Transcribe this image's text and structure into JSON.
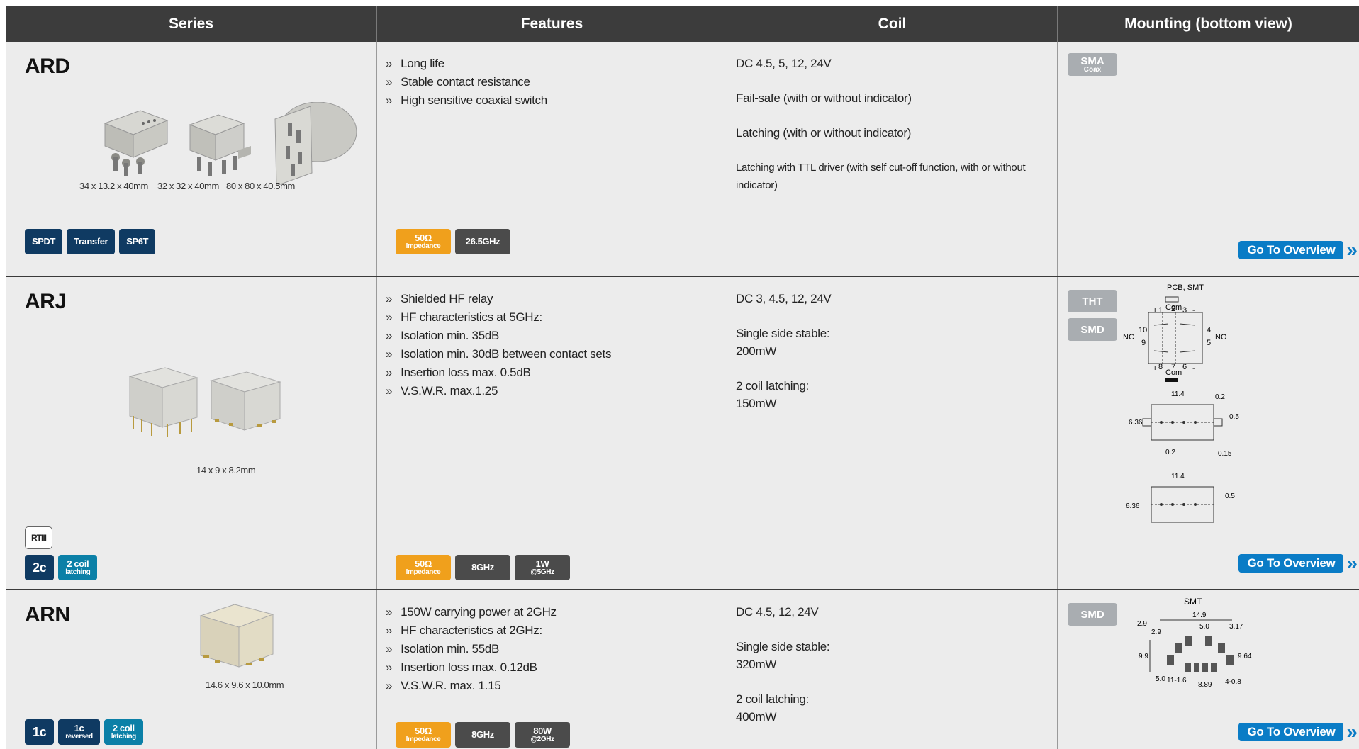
{
  "header": {
    "series": "Series",
    "features": "Features",
    "coil": "Coil",
    "mounting": "Mounting (bottom view)"
  },
  "overview_label": "Go To Overview",
  "rows": [
    {
      "name": "ARD",
      "dims": [
        "34 x 13.2 x 40mm",
        "32 x 32 x 40mm",
        "80 x 80 x 40.5mm"
      ],
      "badges": [
        "SPDT",
        "Transfer",
        "SP6T"
      ],
      "features": [
        "Long life",
        "Stable contact resistance",
        "High sensitive coaxial switch"
      ],
      "feature_badges": [
        {
          "main": "50Ω",
          "sub": "Impedance"
        },
        {
          "main": "26.5GHz"
        }
      ],
      "coil": [
        "DC 4.5, 5, 12, 24V",
        "Fail-safe (with or without indicator)",
        "Latching (with or without indicator)",
        "Latching with TTL driver (with self cut-off function, with or without indicator)"
      ],
      "mounting": [
        {
          "main": "SMA",
          "sub": "Coax"
        }
      ]
    },
    {
      "name": "ARJ",
      "dims": [
        "14 x 9 x 8.2mm"
      ],
      "rt": "RTIII",
      "badges": [
        {
          "main": "2c"
        },
        {
          "main": "2 coil",
          "sub": "latching"
        }
      ],
      "features": [
        "Shielded HF relay",
        "HF characteristics at 5GHz:",
        "Isolation min. 35dB",
        "Isolation min. 30dB between contact sets",
        "Insertion loss max. 0.5dB",
        "V.S.W.R. max.1.25"
      ],
      "feature_badges": [
        {
          "main": "50Ω",
          "sub": "Impedance"
        },
        {
          "main": "8GHz"
        },
        {
          "main": "1W",
          "sub": "@5GHz"
        }
      ],
      "coil": [
        "DC 3, 4.5, 12, 24V",
        "Single side stable:",
        "200mW",
        "2 coil latching:",
        "150mW"
      ],
      "mounting": [
        {
          "main": "THT"
        },
        {
          "main": "SMD"
        }
      ],
      "diagram": {
        "title": "PCB, SMT",
        "com": "Com",
        "pins_top": [
          "1",
          "2",
          "3"
        ],
        "pins_bottom": [
          "8",
          "7",
          "6"
        ],
        "pin_left": [
          "10",
          "9"
        ],
        "pin_right": [
          "4",
          "5"
        ],
        "nc": "NC",
        "no": "NO",
        "plus": "+",
        "minus": "-",
        "w1": "11.4",
        "h1": "6.36",
        "d02a": "0.2",
        "d05": "0.5",
        "d02b": "0.2",
        "d015": "0.15"
      }
    },
    {
      "name": "ARN",
      "dims": [
        "14.6 x 9.6 x 10.0mm"
      ],
      "badges": [
        {
          "main": "1c"
        },
        {
          "main": "1c",
          "sub": "reversed"
        },
        {
          "main": "2 coil",
          "sub": "latching"
        }
      ],
      "features": [
        "150W carrying power at 2GHz",
        "HF characteristics at 2GHz:",
        "Isolation min. 55dB",
        "Insertion loss max. 0.12dB",
        "V.S.W.R. max. 1.15"
      ],
      "feature_badges": [
        {
          "main": "50Ω",
          "sub": "Impedance"
        },
        {
          "main": "8GHz"
        },
        {
          "main": "80W",
          "sub": "@2GHz"
        }
      ],
      "coil": [
        "DC 4.5, 12, 24V",
        "Single side stable:",
        "320mW",
        "2 coil latching:",
        "400mW"
      ],
      "mounting": [
        {
          "main": "SMD"
        }
      ],
      "diagram": {
        "title": "SMT",
        "w": "14.9",
        "a": "5.0",
        "b": "2.9",
        "c": "2.9",
        "d": "3.17",
        "e": "9.9",
        "f": "9.64",
        "g": "5.0",
        "h": "11-1.6",
        "i": "8.89",
        "j": "4-0.8"
      }
    }
  ]
}
